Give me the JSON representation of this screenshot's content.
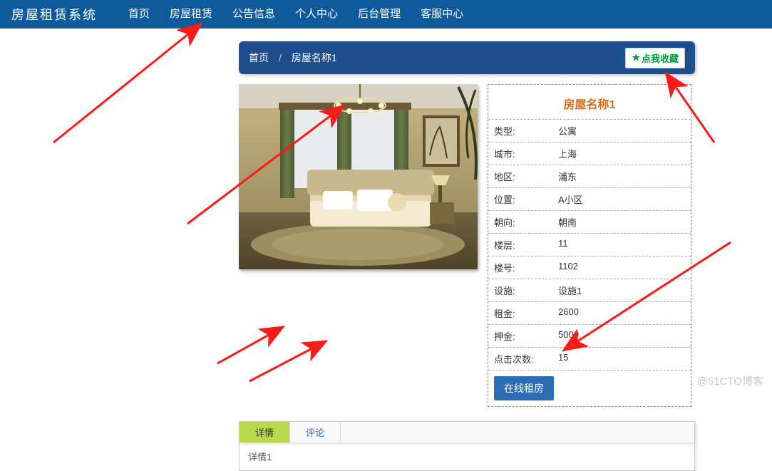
{
  "brand": "房屋租赁系统",
  "nav": [
    "首页",
    "房屋租赁",
    "公告信息",
    "个人中心",
    "后台管理",
    "客服中心"
  ],
  "breadcrumb": {
    "home": "首页",
    "current": "房屋名称1"
  },
  "favorite_label": "点我收藏",
  "detail": {
    "title": "房屋名称1",
    "rows": [
      {
        "k": "类型:",
        "v": "公寓"
      },
      {
        "k": "城市:",
        "v": "上海"
      },
      {
        "k": "地区:",
        "v": "浦东"
      },
      {
        "k": "位置:",
        "v": "A小区"
      },
      {
        "k": "朝向:",
        "v": "朝南"
      },
      {
        "k": "楼层:",
        "v": "11"
      },
      {
        "k": "楼号:",
        "v": "1102"
      },
      {
        "k": "设施:",
        "v": "设施1"
      },
      {
        "k": "租金:",
        "v": "2600"
      },
      {
        "k": "押金:",
        "v": "5000"
      },
      {
        "k": "点击次数:",
        "v": "15"
      }
    ],
    "rent_button": "在线租房"
  },
  "tabs": {
    "detail": "详情",
    "comments": "评论"
  },
  "tab_body": "详情1",
  "watermark": "@51CTO博客"
}
